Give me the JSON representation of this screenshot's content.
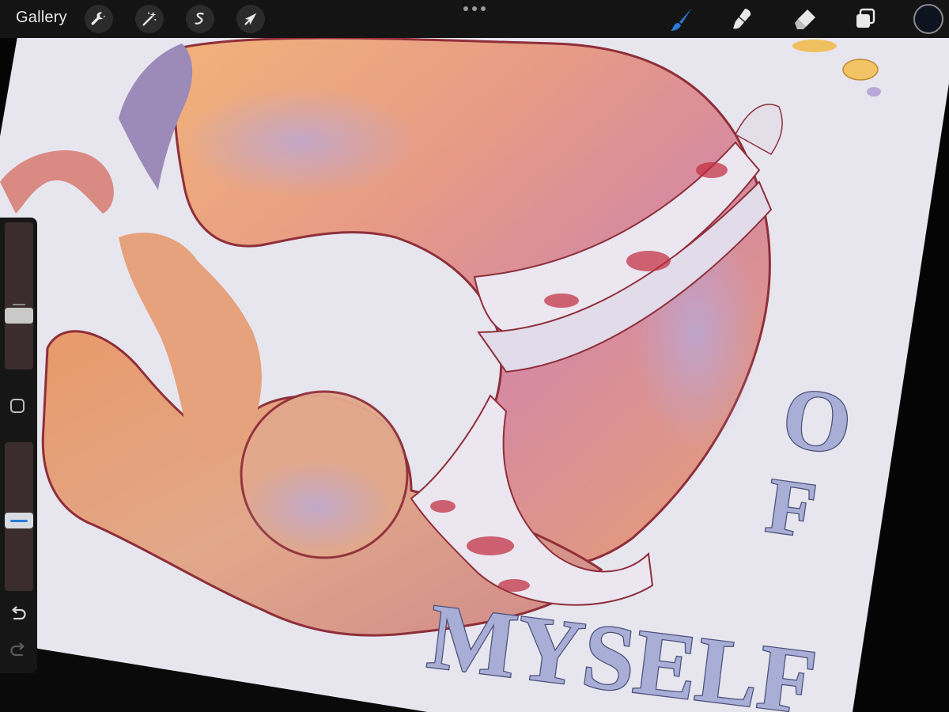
{
  "toolbar": {
    "gallery_label": "Gallery",
    "left_tools": [
      {
        "name": "wrench-icon",
        "label": "Actions"
      },
      {
        "name": "magic-wand-icon",
        "label": "Adjustments"
      },
      {
        "name": "selection-icon",
        "label": "Selection"
      },
      {
        "name": "arrow-cursor-icon",
        "label": "Transform"
      }
    ],
    "right_tools": [
      {
        "name": "brush-icon",
        "active": true,
        "active_color": "#2a7bdc"
      },
      {
        "name": "smudge-icon",
        "active": false
      },
      {
        "name": "eraser-icon",
        "active": false
      },
      {
        "name": "layers-icon",
        "active": false
      }
    ],
    "current_color": "#0d1420"
  },
  "artwork": {
    "text_of": [
      "O",
      "F"
    ],
    "text_myself": "MYSELF",
    "colors": {
      "paper": "#e9e8f1",
      "body_orange": "#e89a6a",
      "body_pink": "#d98a96",
      "bandage": "#e6e2ee",
      "blood": "#c0283a",
      "outline": "#8f2f3a",
      "letters": "#a9aed6"
    }
  },
  "sidebar": {
    "brush_size": 0.35,
    "opacity": 0.47,
    "icons": [
      "modify-square-icon",
      "undo-icon",
      "redo-icon"
    ]
  }
}
